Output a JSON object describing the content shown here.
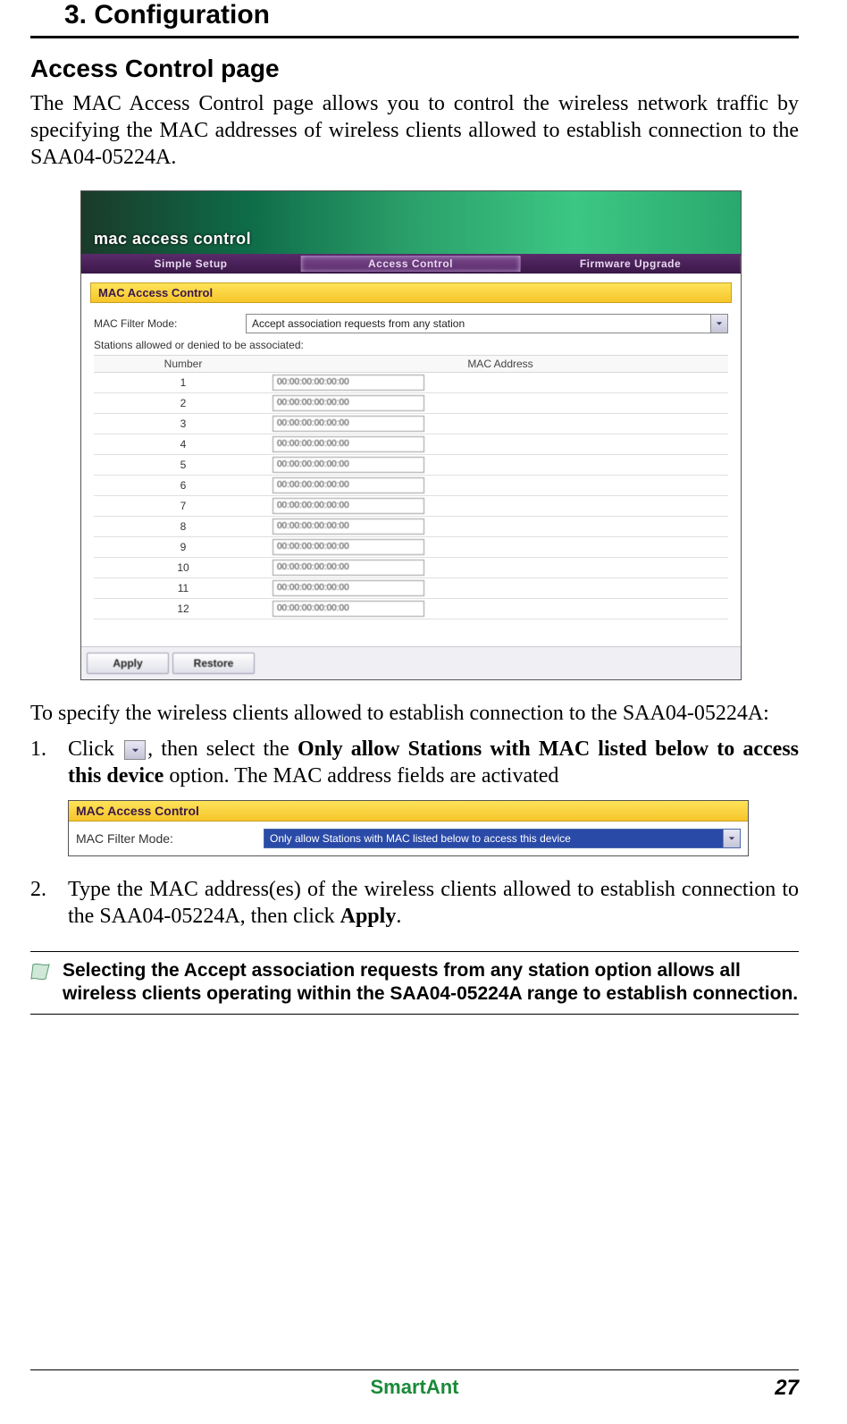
{
  "chapter": "3. Configuration",
  "section": "Access Control page",
  "intro": "The MAC Access Control page allows you to control the wireless network traffic by specifying the MAC addresses of wireless clients allowed to establish connection to the SAA04-05224A.",
  "ui": {
    "banner_title": "mac access control",
    "tabs": [
      "Simple Setup",
      "Access Control",
      "Firmware Upgrade"
    ],
    "active_tab": 1,
    "section_label": "MAC Access Control",
    "filter_label": "MAC Filter Mode:",
    "filter_value": "Accept association requests from any station",
    "stations_label": "Stations allowed or denied to be associated:",
    "col_number": "Number",
    "col_mac": "MAC Address",
    "rows": [
      {
        "n": "1",
        "mac": "00:00:00:00:00:00"
      },
      {
        "n": "2",
        "mac": "00:00:00:00:00:00"
      },
      {
        "n": "3",
        "mac": "00:00:00:00:00:00"
      },
      {
        "n": "4",
        "mac": "00:00:00:00:00:00"
      },
      {
        "n": "5",
        "mac": "00:00:00:00:00:00"
      },
      {
        "n": "6",
        "mac": "00:00:00:00:00:00"
      },
      {
        "n": "7",
        "mac": "00:00:00:00:00:00"
      },
      {
        "n": "8",
        "mac": "00:00:00:00:00:00"
      },
      {
        "n": "9",
        "mac": "00:00:00:00:00:00"
      },
      {
        "n": "10",
        "mac": "00:00:00:00:00:00"
      },
      {
        "n": "11",
        "mac": "00:00:00:00:00:00"
      },
      {
        "n": "12",
        "mac": "00:00:00:00:00:00"
      }
    ],
    "btn_apply": "Apply",
    "btn_restore": "Restore"
  },
  "after_shot": "To specify the wireless clients allowed to establish connection to the SAA04-05224A:",
  "steps": {
    "s1a": "Click ",
    "s1b": ", then select the ",
    "s1_bold": "Only allow Stations with MAC listed below to access this device",
    "s1c": " option. The MAC address fields are activated",
    "s2a": "Type the MAC address(es) of the wireless clients allowed to establish connection to the SAA04-05224A, then click ",
    "s2_bold": "Apply",
    "s2b": "."
  },
  "small_shot": {
    "band": "MAC Access Control",
    "label": "MAC Filter Mode:",
    "value": "Only allow Stations with MAC listed below to access this device"
  },
  "note": "Selecting the Accept association requests from any station option allows all wireless clients operating within the SAA04-05224A range to establish connection.",
  "footer_product": "SmartAnt",
  "page_number": "27"
}
